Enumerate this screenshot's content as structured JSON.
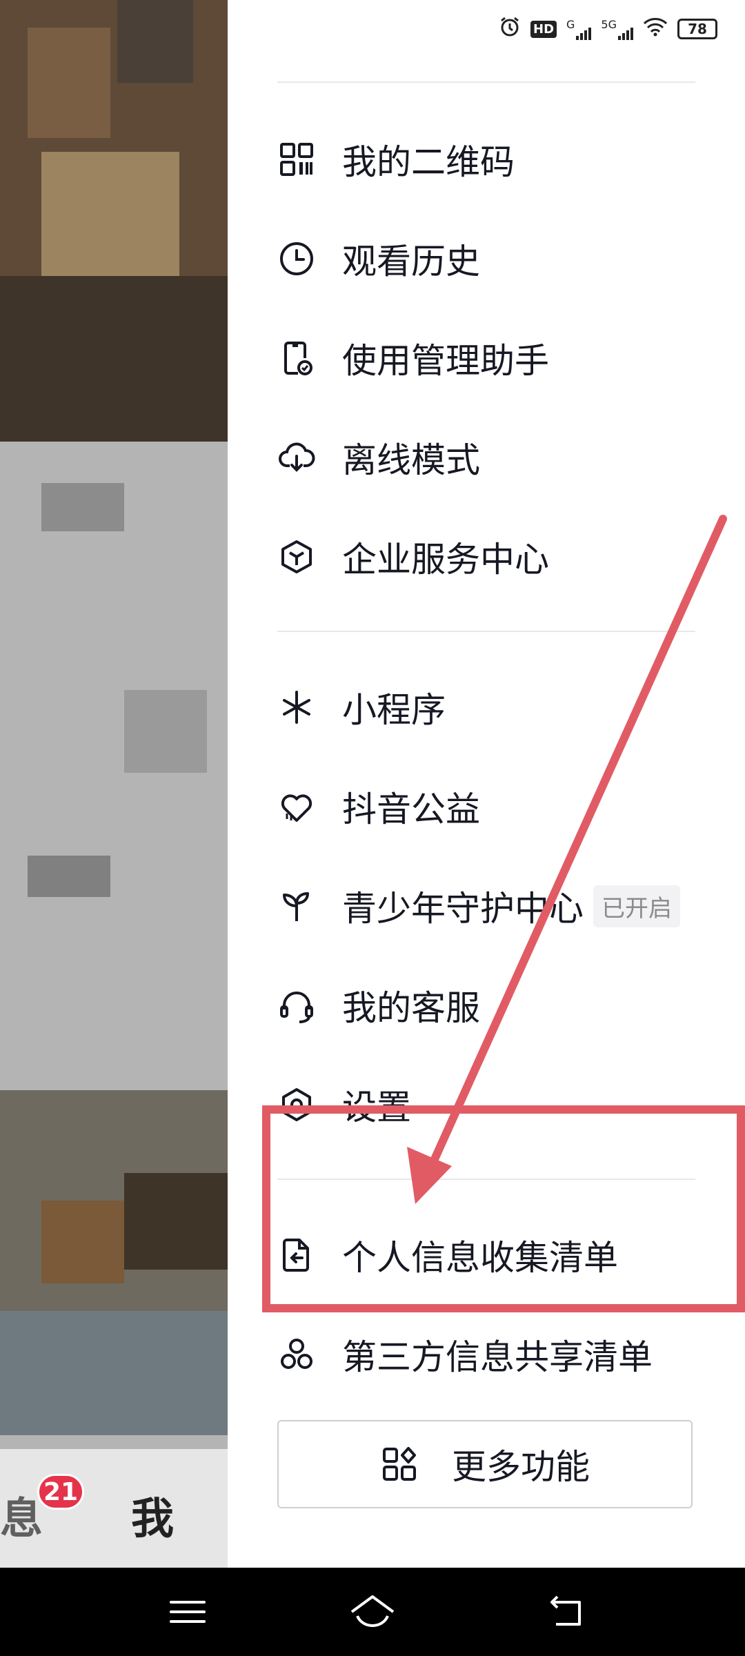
{
  "status_bar": {
    "battery": "78",
    "signal_1_label": "G",
    "signal_2_label": "5G",
    "hd_label": "HD",
    "icons": [
      "alarm-icon",
      "hd-icon",
      "signal-icon",
      "5g-signal-icon",
      "wifi-icon",
      "battery-icon"
    ]
  },
  "left_panel": {
    "tab_message": "息",
    "tab_message_badge": "21",
    "tab_me": "我"
  },
  "drawer": {
    "group1": [
      {
        "label": "我的二维码",
        "icon": "qr-code-icon"
      },
      {
        "label": "观看历史",
        "icon": "clock-icon"
      },
      {
        "label": "使用管理助手",
        "icon": "phone-check-icon"
      },
      {
        "label": "离线模式",
        "icon": "cloud-download-icon"
      },
      {
        "label": "企业服务中心",
        "icon": "cube-icon"
      }
    ],
    "group2": [
      {
        "label": "小程序",
        "icon": "mini-program-icon"
      },
      {
        "label": "抖音公益",
        "icon": "heart-charity-icon"
      },
      {
        "label": "青少年守护中心",
        "icon": "sprout-icon",
        "badge": "已开启"
      },
      {
        "label": "我的客服",
        "icon": "headset-icon"
      },
      {
        "label": "设置",
        "icon": "settings-icon"
      }
    ],
    "group3": [
      {
        "label": "个人信息收集清单",
        "icon": "document-return-icon"
      },
      {
        "label": "第三方信息共享清单",
        "icon": "three-circles-icon"
      }
    ],
    "more_button": {
      "label": "更多功能",
      "icon": "grid-icon"
    }
  },
  "colors": {
    "annotation": "#e15b65",
    "badge": "#e5334b",
    "text": "#161823"
  }
}
